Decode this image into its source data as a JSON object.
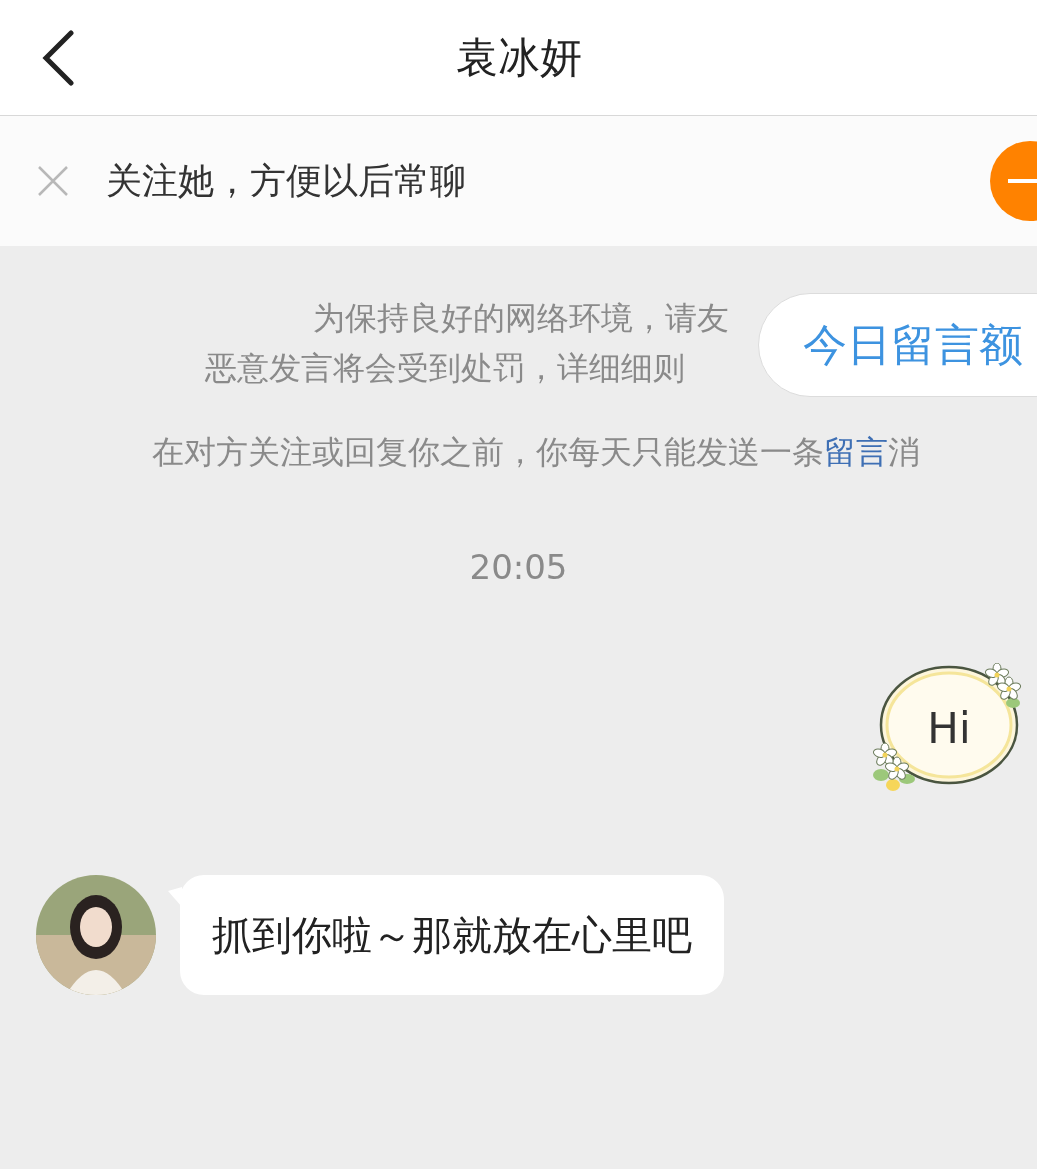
{
  "header": {
    "title": "袁冰妍"
  },
  "follow_banner": {
    "text": "关注她，方便以后常聊"
  },
  "notice": {
    "lines": [
      {
        "parts": [
          {
            "kind": "plain",
            "text": "为保持良好的网络环境，请友"
          }
        ]
      },
      {
        "parts": [
          {
            "kind": "plain",
            "text": "恶意发言将会受到处罚，详细细则"
          }
        ]
      },
      {
        "parts": [
          {
            "kind": "plain",
            "text": "在对方关注或回复你之前，你每天只能发送一条"
          },
          {
            "kind": "link",
            "text": "留言"
          },
          {
            "kind": "plain",
            "text": "消"
          }
        ]
      }
    ]
  },
  "quota_tooltip": {
    "text": "今日留言额"
  },
  "messages": [
    {
      "kind": "time",
      "text": "20:05"
    },
    {
      "kind": "sent",
      "text": "Hi"
    },
    {
      "kind": "received",
      "text": "抓到你啦～那就放在心里吧"
    }
  ]
}
